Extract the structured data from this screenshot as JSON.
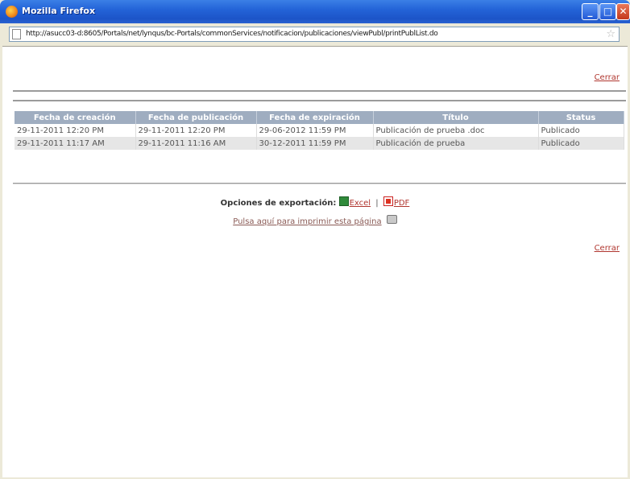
{
  "window": {
    "title": "Mozilla Firefox",
    "url": "http://asucc03-d:8605/Portals/net/lynqus/bc-Portals/commonServices/notificacion/publicaciones/viewPubl/printPublList.do"
  },
  "page": {
    "close_label": "Cerrar",
    "export_label": "Opciones de exportación:",
    "excel_label": "Excel",
    "separator": "|",
    "pdf_label": "PDF",
    "print_label": "Pulsa aquí para imprimir esta página"
  },
  "table": {
    "columns": [
      "Fecha de creación",
      "Fecha de publicación",
      "Fecha de expiración",
      "Título",
      "Status"
    ],
    "rows": [
      [
        "29-11-2011 12:20 PM",
        "29-11-2011 12:20 PM",
        "29-06-2012 11:59 PM",
        "Publicación de prueba .doc",
        "Publicado"
      ],
      [
        "29-11-2011 11:17 AM",
        "29-11-2011 11:16 AM",
        "30-12-2011 11:59 PM",
        "Publicación de prueba",
        "Publicado"
      ]
    ]
  },
  "colors": {
    "titlebar": "#2464d8",
    "table_header": "#9fadc0",
    "link": "#b0362f",
    "row_alt": "#e6e6e6"
  },
  "icons": [
    "firefox-icon",
    "minimize-icon",
    "maximize-icon",
    "close-icon",
    "page-icon",
    "bookmark-star-icon",
    "excel-icon",
    "pdf-icon",
    "printer-icon"
  ]
}
